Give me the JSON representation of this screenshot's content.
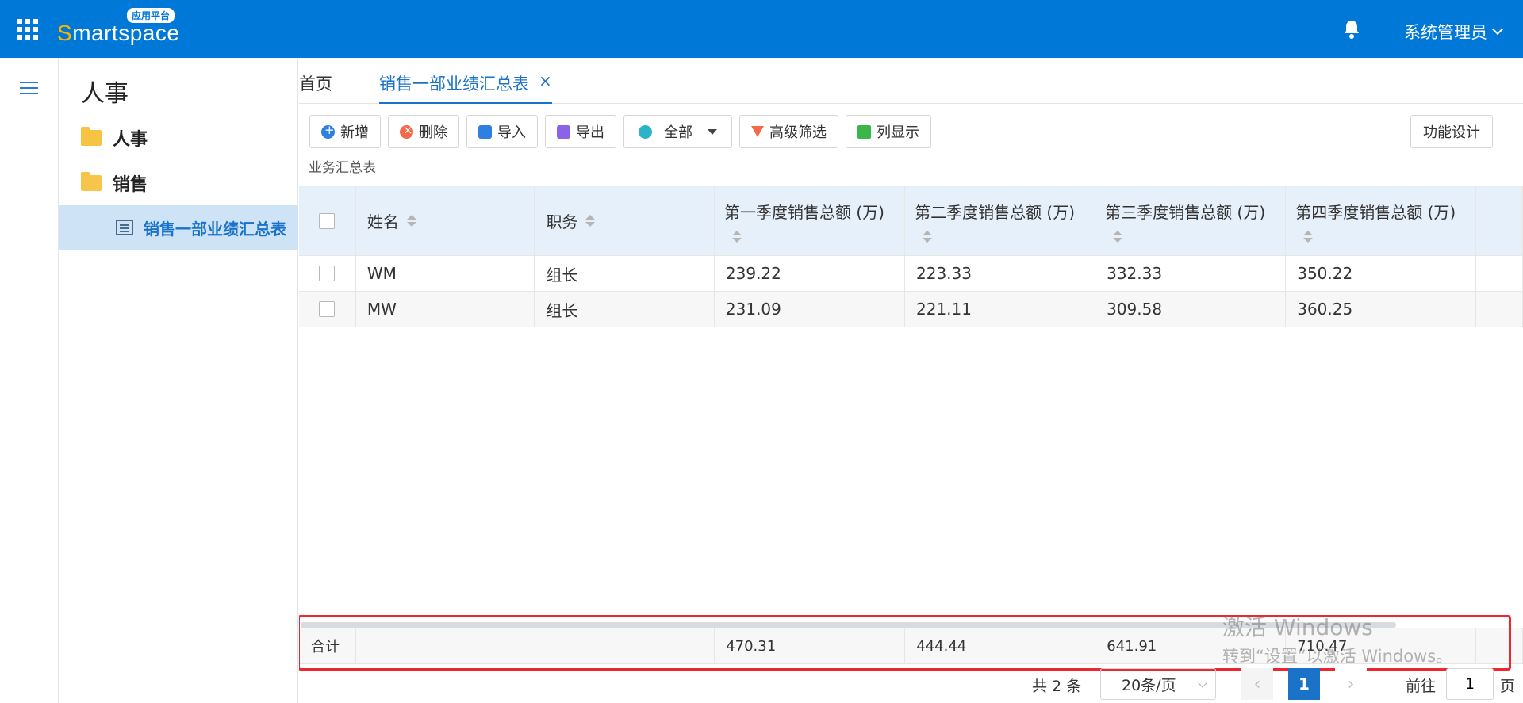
{
  "header": {
    "logo_s": "S",
    "logo_rest": "martspace",
    "logo_badge": "应用平台",
    "user": "系统管理员"
  },
  "sidebar": {
    "title": "人事",
    "items": [
      {
        "label": "人事"
      },
      {
        "label": "销售"
      }
    ],
    "active_item": "销售一部业绩汇总表"
  },
  "tabs": [
    {
      "label": "首页"
    },
    {
      "label": "销售一部业绩汇总表"
    }
  ],
  "toolbar": {
    "add": "新增",
    "delete": "删除",
    "import": "导入",
    "export": "导出",
    "all": "全部",
    "filter": "高级筛选",
    "columns": "列显示",
    "design": "功能设计"
  },
  "caption": "业务汇总表",
  "table": {
    "headers": [
      "姓名",
      "职务",
      "第一季度销售总额 (万)",
      "第二季度销售总额 (万)",
      "第三季度销售总额 (万)",
      "第四季度销售总额 (万)"
    ],
    "rows": [
      [
        "WM",
        "组长",
        "239.22",
        "223.33",
        "332.33",
        "350.22"
      ],
      [
        "MW",
        "组长",
        "231.09",
        "221.11",
        "309.58",
        "360.25"
      ]
    ],
    "sum_label": "合计",
    "sums": [
      "470.31",
      "444.44",
      "641.91",
      "710.47"
    ]
  },
  "watermark": {
    "line1": "激活 Windows",
    "line2": "转到“设置”以激活 Windows。"
  },
  "pagination": {
    "total": "共 2 条",
    "page_size": "20条/页",
    "prev": "‹",
    "current": "1",
    "next": "›",
    "goto": "前往",
    "goto_value": "1",
    "page_suffix": "页"
  }
}
